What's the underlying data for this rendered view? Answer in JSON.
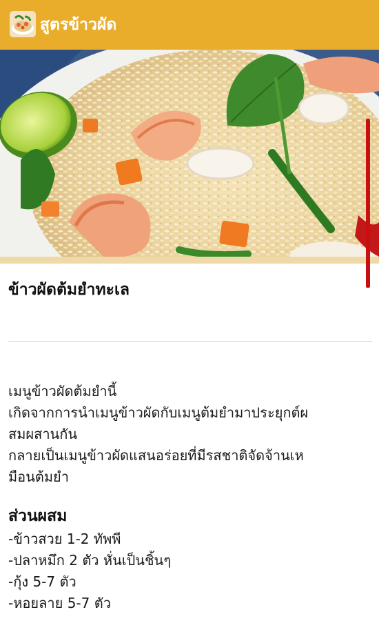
{
  "app": {
    "title": "สูตรข้าวผัด",
    "icon": "fried-rice-icon",
    "accent_color": "#e9ad2b"
  },
  "recipe": {
    "title": "ข้าวผัดต้มยำทะเล",
    "image": "seafood-tom-yum-fried-rice-photo",
    "description_lines": [
      "เมนูข้าวผัดต้มยำนี้",
      "เกิดจากการนำเมนูข้าวผัดกับเมนูต้มยำมาประยุกต์ผ",
      "สมผสานกัน",
      "กลายเป็นเมนูข้าวผัดแสนอร่อยที่มีรสชาติจัดจ้านเห",
      "มือนต้มยำ"
    ],
    "ingredients_heading": "ส่วนผสม",
    "ingredients": [
      "-ข้าวสวย 1-2 ทัพพี",
      "-ปลาหมึก 2 ตัว หั่นเป็นชิ้นๆ",
      "-กุ้ง 5-7 ตัว",
      "-หอยลาย 5-7 ตัว"
    ]
  },
  "scrollbar_color": "#c81010"
}
